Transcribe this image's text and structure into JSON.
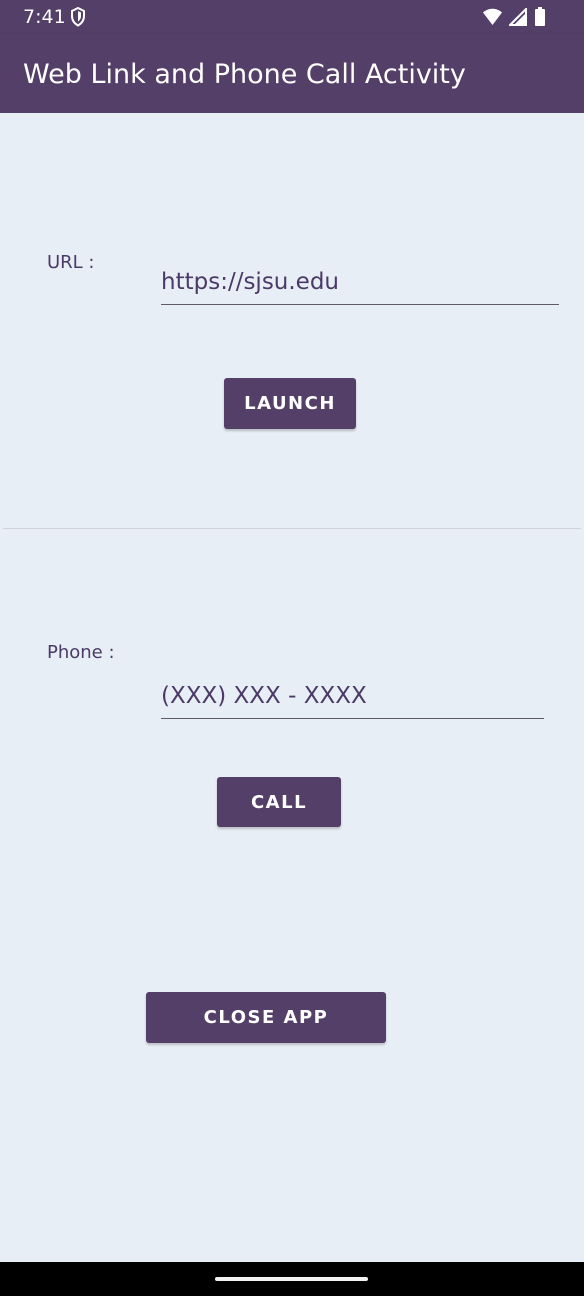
{
  "status_bar": {
    "time": "7:41",
    "icons": [
      "shield-icon",
      "wifi-icon",
      "signal-icon",
      "battery-icon"
    ]
  },
  "app_bar": {
    "title": "Web Link and Phone Call Activity"
  },
  "url_section": {
    "label": "URL :",
    "value": "https://sjsu.edu",
    "button_label": "LAUNCH"
  },
  "phone_section": {
    "label": "Phone :",
    "placeholder": "(XXX) XXX - XXXX",
    "button_label": "CALL"
  },
  "footer": {
    "close_button_label": "CLOSE APP"
  },
  "colors": {
    "primary": "#543f68",
    "background": "#e8eef5",
    "text": "#4b3a67"
  }
}
